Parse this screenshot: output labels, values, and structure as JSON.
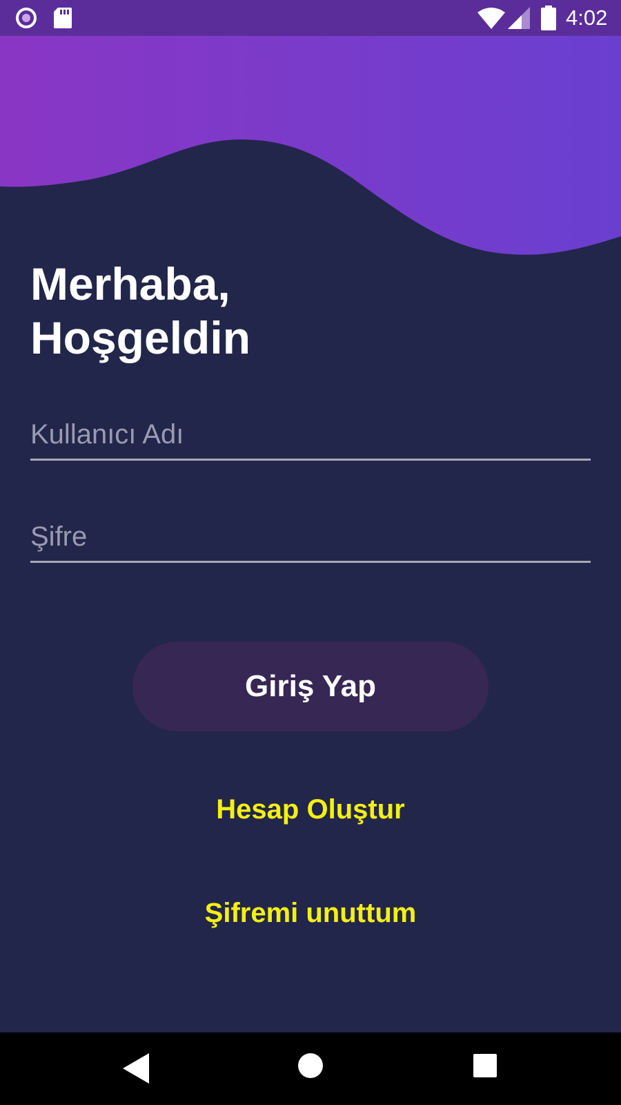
{
  "status_bar": {
    "time": "4:02",
    "icons": [
      "notification-circle-icon",
      "sd-card-icon",
      "wifi-icon",
      "signal-icon",
      "battery-icon"
    ]
  },
  "colors": {
    "background": "#22264a",
    "wave_start": "#8a36c4",
    "wave_end": "#6a3fd0",
    "status_bar": "#5b2d9a",
    "button": "#372754",
    "link": "#f5f00f"
  },
  "greeting": {
    "line1": "Merhaba,",
    "line2": "Hoşgeldin"
  },
  "form": {
    "username_placeholder": "Kullanıcı Adı",
    "username_value": "",
    "password_placeholder": "Şifre",
    "password_value": ""
  },
  "actions": {
    "login_label": "Giriş Yap",
    "create_account_label": "Hesap Oluştur",
    "forgot_password_label": "Şifremi unuttum"
  },
  "nav_bar": {
    "icons": [
      "back-icon",
      "home-icon",
      "recent-apps-icon"
    ]
  }
}
